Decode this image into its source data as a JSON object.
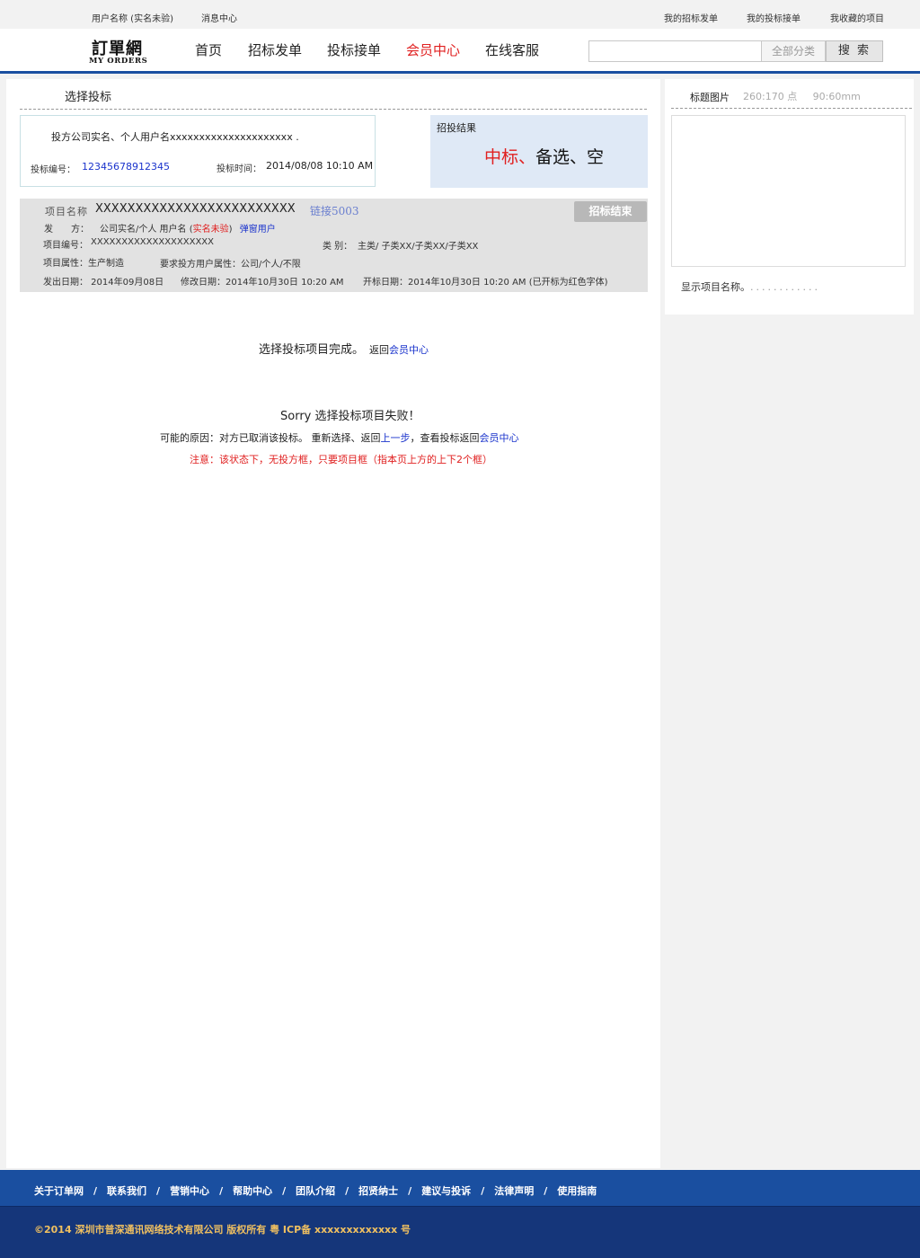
{
  "topbar": {
    "username": "用户名称 (实名未验)",
    "messages": "消息中心",
    "my_tenders": "我的招标发单",
    "my_bids": "我的投标接单",
    "my_favorites": "我收藏的项目"
  },
  "logo": {
    "cn": "訂單網",
    "en": "MY ORDERS"
  },
  "nav": {
    "home": "首页",
    "tender": "招标发单",
    "bid": "投标接单",
    "member": "会员中心",
    "service": "在线客服"
  },
  "search": {
    "placeholder": "",
    "category": "全部分类",
    "button": "搜 索"
  },
  "main": {
    "title": "选择投标",
    "bidder": {
      "name": "投方公司实名、个人用户名xxxxxxxxxxxxxxxxxxxxx .",
      "bid_no_label": "投标编号：",
      "bid_no": "12345678912345",
      "bid_time_label": "投标时间：",
      "bid_time": "2014/08/08 10:10 AM"
    },
    "result": {
      "title": "招投结果",
      "win": "中标、",
      "rest": "备选、空"
    },
    "project": {
      "name_label": "项目名称",
      "name_value": "XXXXXXXXXXXXXXXXXXXXXXXXX",
      "link": "链接5003",
      "status": "招标结束",
      "issuer_label": "发　　方：",
      "issuer_value": "公司实名/个人 用户名 (",
      "issuer_unverified": "实名未验",
      "issuer_close": ")",
      "issuer_popup": "弹窗用户",
      "code_label": "项目编号：",
      "code_value": "XXXXXXXXXXXXXXXXXXXX",
      "category_label": "类  别：",
      "category_value": "主类/ 子类XX/子类XX/子类XX",
      "attr": "项目属性：生产制造",
      "require": "要求投方用户属性：公司/个人/不限",
      "issue_date": "发出日期： 2014年09月08日",
      "modify_date": "修改日期：2014年10月30日 10:20  AM",
      "open_date": "开标日期：2014年10月30日 10:20  AM (已开标为红色字体)"
    },
    "done": {
      "text": "选择投标项目完成。",
      "back": "返回",
      "link": "会员中心"
    },
    "fail": {
      "sorry": "Sorry  选择投标项目失败！",
      "reason_a": "可能的原因：对方已取消该投标。 重新选择、返回",
      "reason_link1": "上一步",
      "reason_b": "，查看投标返回",
      "reason_link2": "会员中心",
      "note": "注意：该状态下，无投方框，只要项目框（指本页上方的上下2个框）"
    }
  },
  "sidebar": {
    "title": "标题图片",
    "size": "260:170 点     90:60mm",
    "caption": "显示项目名称。",
    "dots": "............"
  },
  "footer": {
    "links": [
      "关于订单网",
      "联系我们",
      "营销中心",
      "帮助中心",
      "团队介绍",
      "招贤纳士",
      "建议与投诉",
      "法律声明",
      "使用指南"
    ],
    "copyright": "©2014 深圳市普深通讯网络技术有限公司 版权所有 粤 ICP备 xxxxxxxxxxxxx 号"
  },
  "colors": {
    "brand_blue": "#1a4fa0",
    "footer_dark": "#15367a",
    "accent_red": "#e02020",
    "link_blue": "#1a33cc"
  }
}
